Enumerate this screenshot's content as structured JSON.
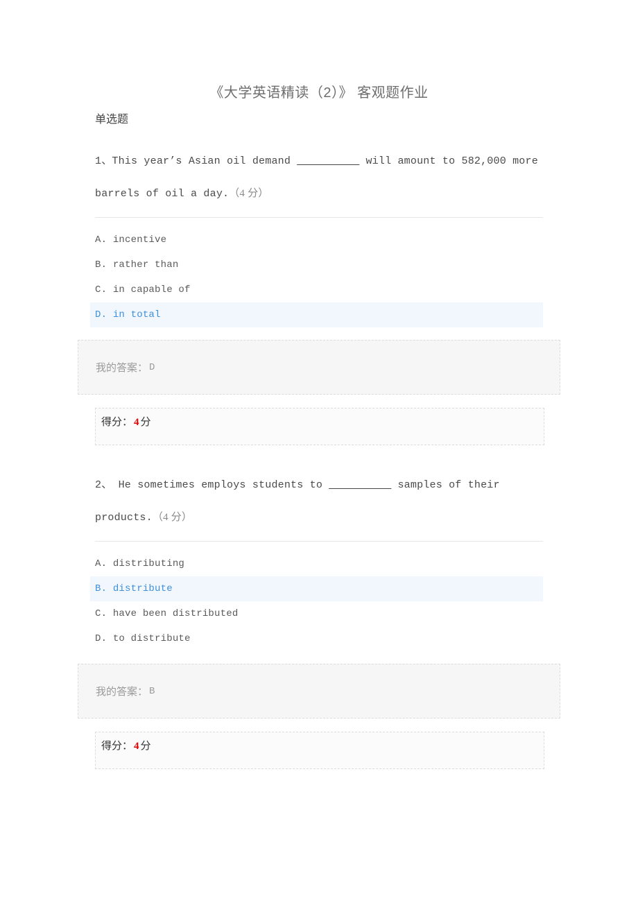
{
  "document": {
    "title": "《大学英语精读（2）》 客观题作业",
    "section_label": "单选题"
  },
  "labels": {
    "my_answer_prefix": "我的答案：",
    "score_prefix": "得分：",
    "score_suffix": "分"
  },
  "colors": {
    "selected_text": "#3d8fdb",
    "selected_background": "#f1f7fd",
    "score_number": "#e60000",
    "title_text": "#6e6e6e",
    "body_text": "#4a4a4a"
  },
  "questions": [
    {
      "number": "1、",
      "stem_before_blank": "This year’s Asian oil demand ",
      "blank": "__________",
      "stem_after_blank": " will amount to 582,000 more barrels of oil a day.",
      "points_tag": "（4 分）",
      "options": [
        {
          "letter": "A.",
          "text": "incentive",
          "selected": false
        },
        {
          "letter": "B.",
          "text": "rather than",
          "selected": false
        },
        {
          "letter": "C.",
          "text": "in capable of",
          "selected": false
        },
        {
          "letter": "D.",
          "text": "in total",
          "selected": true
        }
      ],
      "my_answer": "D",
      "score": "4"
    },
    {
      "number": "2、",
      "stem_before_blank": " He sometimes employs students to ",
      "blank": "__________",
      "stem_after_blank": " samples of their products.",
      "points_tag": "（4 分）",
      "options": [
        {
          "letter": "A.",
          "text": "distributing",
          "selected": false
        },
        {
          "letter": "B.",
          "text": "distribute",
          "selected": true
        },
        {
          "letter": "C.",
          "text": "have been distributed",
          "selected": false
        },
        {
          "letter": "D.",
          "text": "to distribute",
          "selected": false
        }
      ],
      "my_answer": "B",
      "score": "4"
    }
  ]
}
